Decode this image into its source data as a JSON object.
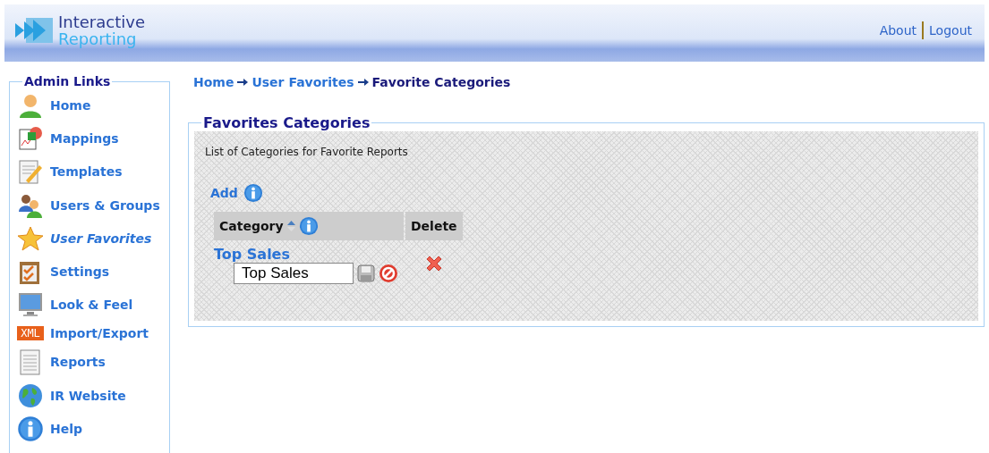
{
  "header": {
    "logo_line_1": "Interactive",
    "logo_line_2": "Reporting",
    "links": [
      "About",
      "Logout"
    ]
  },
  "sidebar": {
    "title": "Admin Links",
    "items": [
      {
        "label": "Home",
        "kind": "person",
        "selected": false
      },
      {
        "label": "Mappings",
        "kind": "chart",
        "selected": false
      },
      {
        "label": "Templates",
        "kind": "document-pencil",
        "selected": false
      },
      {
        "label": "Users & Groups",
        "kind": "people",
        "selected": false
      },
      {
        "label": "User Favorites",
        "kind": "star",
        "selected": true
      },
      {
        "label": "Settings",
        "kind": "clipboard",
        "selected": false
      },
      {
        "label": "Look & Feel",
        "kind": "monitor",
        "selected": false
      },
      {
        "label": "Import/Export",
        "kind": "xml",
        "badge": "XML",
        "selected": false
      },
      {
        "label": "Reports",
        "kind": "document",
        "selected": false
      },
      {
        "label": "IR Website",
        "kind": "globe",
        "selected": false
      },
      {
        "label": "Help",
        "kind": "info",
        "selected": false
      }
    ]
  },
  "breadcrumb": [
    {
      "label": "Home",
      "selected": false
    },
    {
      "label": "User Favorites",
      "selected": false
    },
    {
      "label": "Favorite Categories",
      "selected": true
    }
  ],
  "panel": {
    "title": "Favorites Categories",
    "description": "List of Categories for Favorite Reports",
    "add_label": "Add",
    "table": {
      "columns": [
        "Category",
        "Delete"
      ],
      "rows": [
        {
          "category": "Top Sales",
          "edit_value": "Top Sales"
        }
      ]
    }
  }
}
